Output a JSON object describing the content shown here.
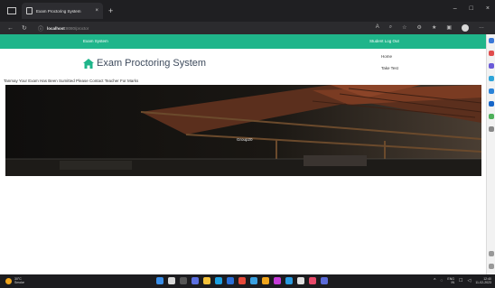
{
  "browser": {
    "tab_title": "Exam Proctoring System",
    "tab_close": "×",
    "new_tab": "+",
    "url_host": "localhost",
    "url_path": ":8080/proctor",
    "window_buttons": [
      "–",
      "□",
      "×"
    ]
  },
  "site": {
    "nav_left": "Exam System",
    "nav_right": "Student Log Out",
    "brand": "Exam Proctoring System",
    "links": [
      "Home",
      "Take Test"
    ],
    "message": "Tanmay Your Exam Has Been Sumitted Please Contact Teacher For Marks",
    "hero_text": "Group20",
    "accent_color": "#1fb58a"
  },
  "taskbar": {
    "weather_temp": "30°C",
    "weather_desc": "Smoke",
    "lang": "ENG",
    "lang_region": "IN",
    "time": "12:40",
    "date": "11-02-2023"
  }
}
